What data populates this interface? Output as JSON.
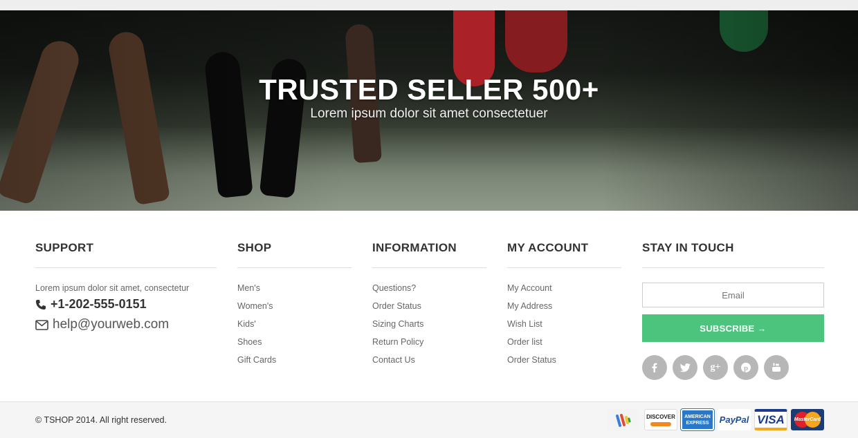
{
  "hero": {
    "title": "TRUSTED SELLER 500+",
    "subtitle": "Lorem ipsum dolor sit amet consectetuer"
  },
  "support": {
    "heading": "SUPPORT",
    "text": "Lorem ipsum dolor sit amet, consectetur",
    "phone": "+1-202-555-0151",
    "email": "help@yourweb.com"
  },
  "shop": {
    "heading": "SHOP",
    "links": [
      "Men's",
      "Women's",
      "Kids'",
      "Shoes",
      "Gift Cards"
    ]
  },
  "information": {
    "heading": "INFORMATION",
    "links": [
      "Questions?",
      "Order Status",
      "Sizing Charts",
      "Return Policy",
      "Contact Us"
    ]
  },
  "account": {
    "heading": "MY ACCOUNT",
    "links": [
      "My Account",
      "My Address",
      "Wish List",
      "Order list",
      "Order Status"
    ]
  },
  "stay": {
    "heading": "STAY IN TOUCH",
    "email_placeholder": "Email",
    "subscribe_label": "SUBSCRIBE →",
    "socials": [
      "facebook-icon",
      "twitter-icon",
      "google-plus-icon",
      "pinterest-icon",
      "youtube-icon"
    ]
  },
  "footer": {
    "copyright": "© TSHOP 2014. All right reserved.",
    "payments": [
      {
        "name": "Google Wallet",
        "label": ""
      },
      {
        "name": "Discover",
        "label": "DISCOVER"
      },
      {
        "name": "American Express",
        "label": "AMERICAN EXPRESS"
      },
      {
        "name": "PayPal",
        "label": "PayPal"
      },
      {
        "name": "Visa",
        "label": "VISA"
      },
      {
        "name": "MasterCard",
        "label": "MasterCard"
      }
    ]
  },
  "colors": {
    "accent": "#4cc47e",
    "social": "#b7b7b7"
  }
}
